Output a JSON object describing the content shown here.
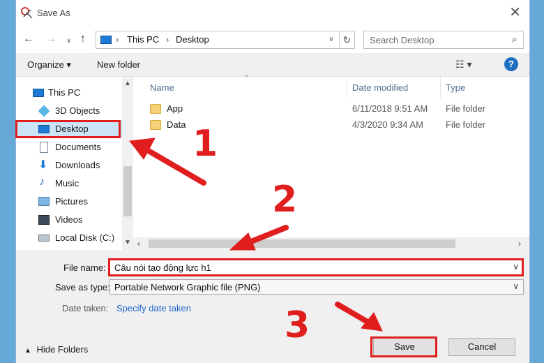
{
  "window": {
    "title": "Save As",
    "close_label": "✕"
  },
  "address_bar": {
    "segments": [
      "This PC",
      "Desktop"
    ]
  },
  "search": {
    "placeholder": "Search Desktop"
  },
  "toolbar": {
    "organize_label": "Organize ▾",
    "new_folder_label": "New folder",
    "help_label": "?"
  },
  "nav_pane": {
    "items": [
      {
        "label": "This PC",
        "icon": "computer-icon"
      },
      {
        "label": "3D Objects",
        "icon": "cube-icon"
      },
      {
        "label": "Desktop",
        "icon": "desktop-icon",
        "selected": true
      },
      {
        "label": "Documents",
        "icon": "document-icon"
      },
      {
        "label": "Downloads",
        "icon": "download-icon"
      },
      {
        "label": "Music",
        "icon": "music-icon"
      },
      {
        "label": "Pictures",
        "icon": "picture-icon"
      },
      {
        "label": "Videos",
        "icon": "video-icon"
      },
      {
        "label": "Local Disk (C:)",
        "icon": "disk-icon"
      }
    ]
  },
  "file_list": {
    "columns": [
      "Name",
      "Date modified",
      "Type"
    ],
    "rows": [
      {
        "name": "App",
        "date": "6/11/2018 9:51 AM",
        "type": "File folder"
      },
      {
        "name": "Data",
        "date": "4/3/2020 9:34 AM",
        "type": "File folder"
      }
    ]
  },
  "form": {
    "file_name_label": "File name:",
    "file_name_value": "Câu nói tạo động lực h1",
    "save_type_label": "Save as type:",
    "save_type_value": "Portable Network Graphic file (PNG)",
    "date_taken_label": "Date taken:",
    "date_taken_link": "Specify date taken"
  },
  "footer": {
    "hide_folders_label": "Hide Folders",
    "save_label": "Save",
    "cancel_label": "Cancel"
  },
  "annotations": {
    "step1": "1",
    "step2": "2",
    "step3": "3",
    "highlight_color": "#e01e1e"
  }
}
